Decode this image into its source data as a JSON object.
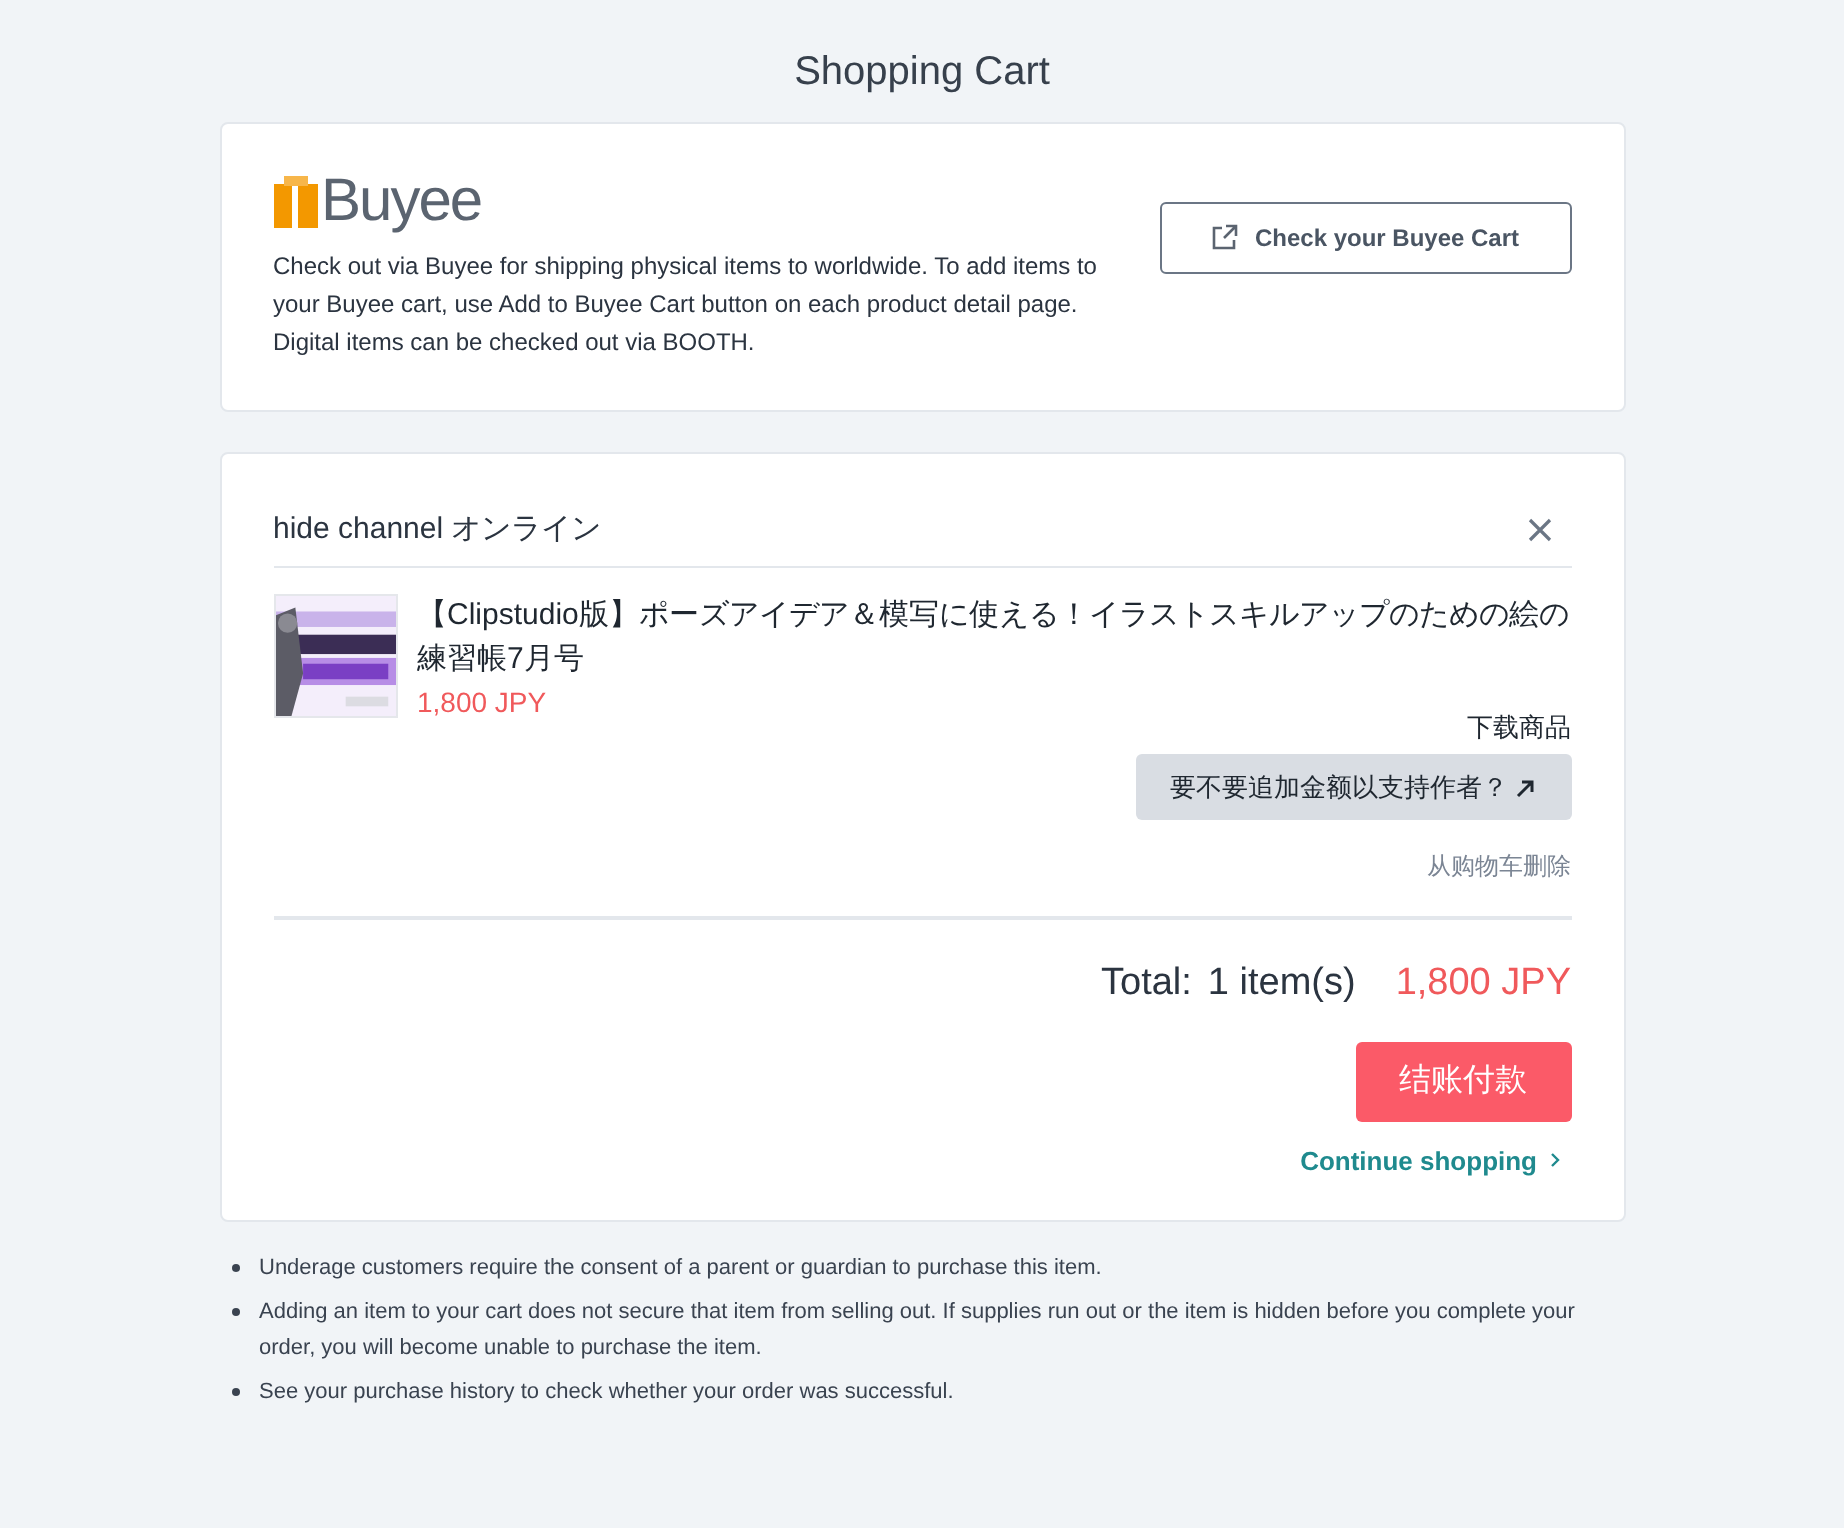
{
  "page_title": "Shopping Cart",
  "buyee": {
    "logo": "Buyee",
    "description_lines": [
      "Check out via Buyee for shipping physical items to worldwide. To add items to your Buyee cart, use Add to Buyee Cart button on each product detail page.",
      "Digital items can be checked out via BOOTH."
    ],
    "button": "Check your Buyee Cart"
  },
  "cart": {
    "shop": "hide channel オンライン",
    "items": [
      {
        "title": "【Clipstudio版】ポーズアイデア＆模写に使える！イラストスキルアップのための絵の練習帳7月号",
        "price": "1,800 JPY",
        "type": "下载商品",
        "support_button": "要不要追加金额以支持作者？",
        "remove": "从购物车删除"
      }
    ],
    "total_label": "Total:",
    "count": "1 item(s)",
    "total": "1,800 JPY",
    "checkout": "结账付款",
    "continue": "Continue shopping"
  },
  "notes": [
    "Underage customers require the consent of a parent or guardian to purchase this item.",
    "Adding an item to your cart does not secure that item from selling out. If supplies run out or the item is hidden before you complete your order, you will become unable to purchase the item.",
    "See your purchase history to check whether your order was successful."
  ]
}
